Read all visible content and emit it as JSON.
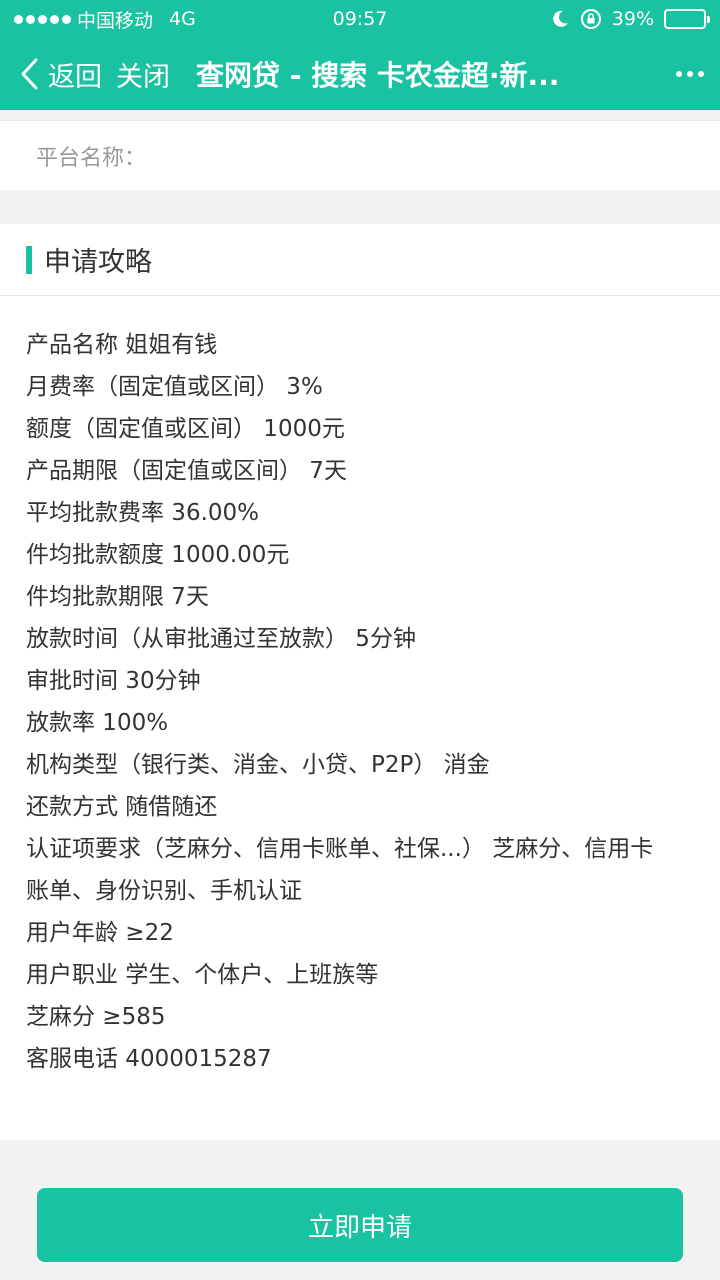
{
  "status_bar": {
    "carrier": "中国移动",
    "network": "4G",
    "time": "09:57",
    "battery": "39%",
    "battery_level": 0.39
  },
  "nav": {
    "back_label": "返回",
    "close_label": "关闭",
    "title": "查网贷 - 搜索 卡农金超·新..."
  },
  "platform": {
    "label": "平台名称："
  },
  "strategy": {
    "title": "申请攻略",
    "lines": [
      "产品名称 姐姐有钱",
      "月费率（固定值或区间） 3%",
      "额度（固定值或区间） 1000元",
      "产品期限（固定值或区间） 7天",
      "平均批款费率 36.00%",
      "件均批款额度 1000.00元",
      "件均批款期限 7天",
      "放款时间（从审批通过至放款） 5分钟",
      "审批时间 30分钟",
      "放款率 100%",
      "机构类型（银行类、消金、小贷、P2P） 消金",
      "还款方式 随借随还",
      "认证项要求（芝麻分、信用卡账单、社保...） 芝麻分、信用卡",
      "账单、身份识别、手机认证",
      "用户年龄 ≥22",
      "用户职业 学生、个体户、上班族等",
      "芝麻分 ≥585",
      "客服电话 4000015287"
    ]
  },
  "footer": {
    "apply_label": "立即申请"
  },
  "colors": {
    "accent": "#19c2a0"
  }
}
